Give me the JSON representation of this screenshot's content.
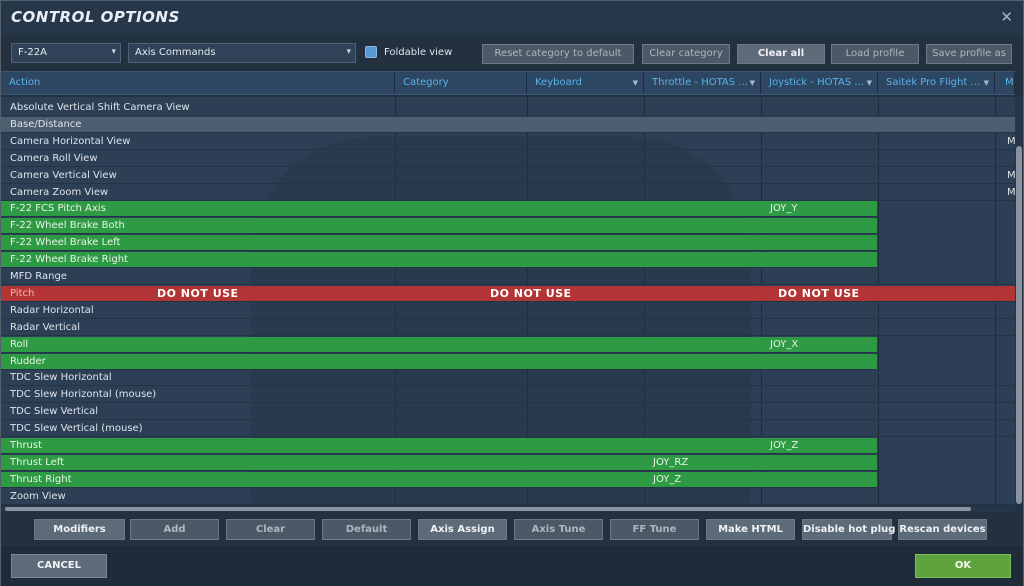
{
  "window": {
    "title": "CONTROL OPTIONS",
    "close_glyph": "✕"
  },
  "toolbar": {
    "aircraft": "F-22A",
    "category_filter": "Axis Commands",
    "foldable_label": "Foldable view",
    "buttons": [
      "Reset category to default",
      "Clear category",
      "Clear all",
      "Load profile",
      "Save profile as"
    ]
  },
  "columns": [
    "Action",
    "Category",
    "Keyboard",
    "Throttle - HOTAS ...",
    "Joystick - HOTAS ...",
    "Saitek Pro Flight ...",
    "M"
  ],
  "rows": [
    {
      "action": "Absolute Vertical Shift Camera View",
      "state": "normal",
      "cells": [
        "",
        "",
        "",
        "",
        "",
        ""
      ]
    },
    {
      "action": "Base/Distance",
      "state": "selected",
      "cells": [
        "",
        "",
        "",
        "",
        "",
        ""
      ]
    },
    {
      "action": "Camera Horizontal View",
      "state": "normal",
      "cells": [
        "",
        "",
        "",
        "",
        "",
        "M"
      ]
    },
    {
      "action": "Camera Roll View",
      "state": "normal",
      "cells": [
        "",
        "",
        "",
        "",
        "",
        ""
      ]
    },
    {
      "action": "Camera Vertical View",
      "state": "normal",
      "cells": [
        "",
        "",
        "",
        "",
        "",
        "M"
      ]
    },
    {
      "action": "Camera Zoom View",
      "state": "normal",
      "cells": [
        "",
        "",
        "",
        "",
        "",
        "M"
      ]
    },
    {
      "action": "F-22 FCS Pitch Axis",
      "state": "green",
      "cells": [
        "",
        "",
        "",
        "JOY_Y",
        "",
        ""
      ]
    },
    {
      "action": "F-22 Wheel Brake Both",
      "state": "green",
      "cells": [
        "",
        "",
        "",
        "",
        "",
        ""
      ]
    },
    {
      "action": "F-22 Wheel Brake Left",
      "state": "green",
      "cells": [
        "",
        "",
        "",
        "",
        "",
        ""
      ]
    },
    {
      "action": "F-22 Wheel Brake Right",
      "state": "green",
      "cells": [
        "",
        "",
        "",
        "",
        "",
        ""
      ]
    },
    {
      "action": "MFD Range",
      "state": "normal",
      "cells": [
        "",
        "",
        "",
        "",
        "",
        ""
      ]
    },
    {
      "action": "Pitch",
      "state": "red",
      "cells": [
        "",
        "",
        "",
        "",
        "",
        ""
      ]
    },
    {
      "action": "Radar Horizontal",
      "state": "normal",
      "cells": [
        "",
        "",
        "",
        "",
        "",
        ""
      ]
    },
    {
      "action": "Radar Vertical",
      "state": "normal",
      "cells": [
        "",
        "",
        "",
        "",
        "",
        ""
      ]
    },
    {
      "action": "Roll",
      "state": "green",
      "cells": [
        "",
        "",
        "",
        "JOY_X",
        "",
        ""
      ]
    },
    {
      "action": "Rudder",
      "state": "green",
      "cells": [
        "",
        "",
        "",
        "",
        "",
        ""
      ]
    },
    {
      "action": "TDC Slew Horizontal",
      "state": "normal",
      "cells": [
        "",
        "",
        "",
        "",
        "",
        ""
      ]
    },
    {
      "action": "TDC Slew Horizontal (mouse)",
      "state": "normal",
      "cells": [
        "",
        "",
        "",
        "",
        "",
        ""
      ]
    },
    {
      "action": "TDC Slew Vertical",
      "state": "normal",
      "cells": [
        "",
        "",
        "",
        "",
        "",
        ""
      ]
    },
    {
      "action": "TDC Slew Vertical (mouse)",
      "state": "normal",
      "cells": [
        "",
        "",
        "",
        "",
        "",
        ""
      ]
    },
    {
      "action": "Thrust",
      "state": "green",
      "cells": [
        "",
        "",
        "",
        "JOY_Z",
        "",
        ""
      ]
    },
    {
      "action": "Thrust Left",
      "state": "green",
      "cells": [
        "",
        "",
        "JOY_RZ",
        "",
        "",
        ""
      ]
    },
    {
      "action": "Thrust Right",
      "state": "green",
      "cells": [
        "",
        "",
        "JOY_Z",
        "",
        "",
        ""
      ]
    },
    {
      "action": "Zoom View",
      "state": "normal",
      "cells": [
        "",
        "",
        "",
        "",
        "",
        ""
      ]
    }
  ],
  "warning_text": "DO NOT USE",
  "bottom_buttons": [
    "Modifiers",
    "Add",
    "Clear",
    "Default",
    "Axis Assign",
    "Axis Tune",
    "FF Tune",
    "Make HTML",
    "Disable hot plug",
    "Rescan devices"
  ],
  "footer": {
    "cancel": "CANCEL",
    "ok": "OK"
  }
}
